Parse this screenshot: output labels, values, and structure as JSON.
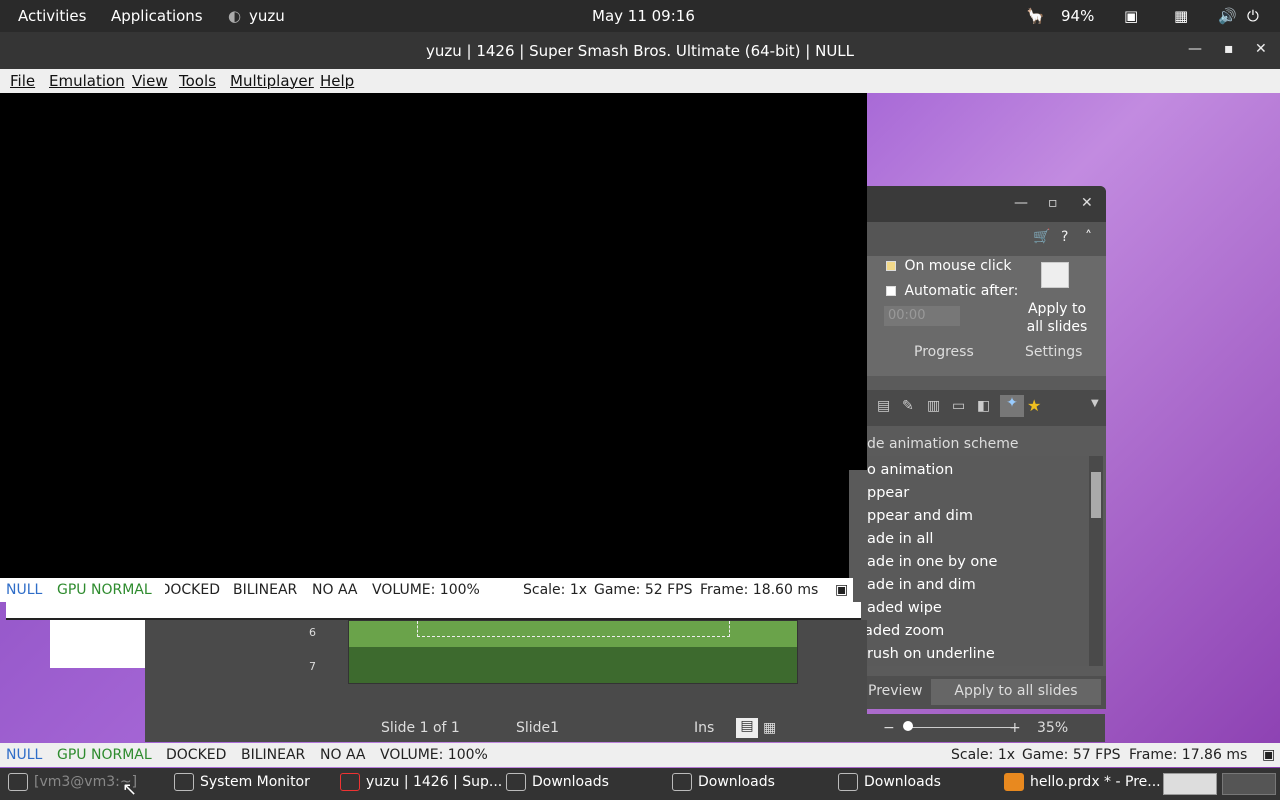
{
  "topbar": {
    "activities": "Activities",
    "applications": "Applications",
    "app_name": "yuzu",
    "clock": "May 11  09:16",
    "battery": "94%"
  },
  "window": {
    "title": "yuzu | 1426  | Super Smash Bros. Ultimate (64-bit) | NULL"
  },
  "menu": [
    "File",
    "Emulation",
    "View",
    "Tools",
    "Multiplayer",
    "Help"
  ],
  "status_inner": {
    "renderer": "NULL",
    "gpu": "GPU NORMAL",
    "dock": "DOCKED",
    "filter": "BILINEAR",
    "aa": "NO AA",
    "volume": "VOLUME: 100%",
    "scale": "Scale: 1x",
    "fps": "Game: 52 FPS",
    "frame": "Frame: 18.60 ms"
  },
  "status_outer": {
    "renderer": "NULL",
    "gpu": "GPU NORMAL",
    "dock": "DOCKED",
    "filter": "BILINEAR",
    "aa": "NO AA",
    "volume": "VOLUME: 100%",
    "scale": "Scale: 1x",
    "fps": "Game: 57 FPS",
    "frame": "Frame: 17.86 ms"
  },
  "presentation": {
    "on_mouse_click": "On mouse click",
    "automatic_after": "Automatic after:",
    "time_value": "00:00",
    "apply_all_button": "Apply to all slides",
    "progress_label": "Progress",
    "settings_label": "Settings",
    "scheme_header": "de animation scheme",
    "schemes": [
      "o animation",
      "ppear",
      "ppear and dim",
      "ade in all",
      "ade in one by one",
      "ade in and dim",
      "aded wipe",
      "Faded zoom",
      "Brush on underline"
    ],
    "preview_label": "Preview",
    "apply_all_slides": "Apply to all slides",
    "slide_counter": "Slide 1 of 1",
    "slide_name": "Slide1",
    "ins": "Ins",
    "zoom": "35%",
    "ruler_6": "6",
    "ruler_7": "7"
  },
  "taskbar": [
    {
      "label": "[vm3@vm3:~]",
      "icon": "terminal-icon"
    },
    {
      "label": "System Monitor",
      "icon": "monitor-icon"
    },
    {
      "label": "yuzu | 1426  | Sup...",
      "icon": "yuzu-icon"
    },
    {
      "label": "Downloads",
      "icon": "folder-icon"
    },
    {
      "label": "Downloads",
      "icon": "folder-icon"
    },
    {
      "label": "Downloads",
      "icon": "folder-icon"
    },
    {
      "label": "hello.prdx * - Pre...",
      "icon": "presentation-icon"
    }
  ]
}
